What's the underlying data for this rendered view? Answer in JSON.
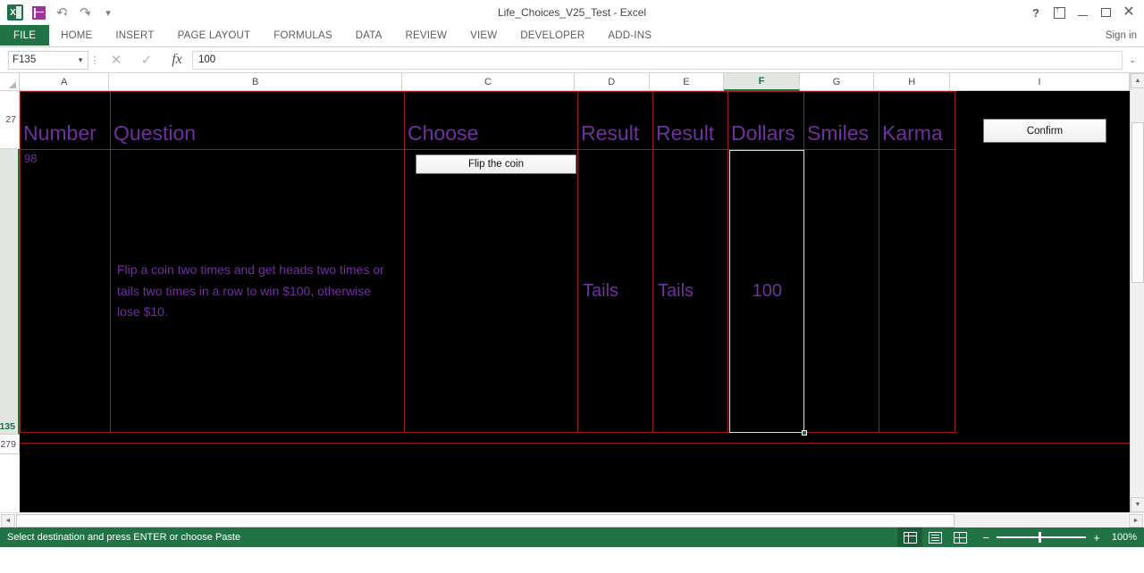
{
  "window": {
    "title": "Life_Choices_V25_Test - Excel",
    "quick_access": [
      {
        "name": "excel-logo",
        "label": "X"
      },
      {
        "name": "save-icon",
        "label": ""
      },
      {
        "name": "undo-icon",
        "label": "↶"
      },
      {
        "name": "redo-icon",
        "label": "↷"
      },
      {
        "name": "customize-qat-icon",
        "label": "▾"
      }
    ],
    "controls": {
      "help": "?",
      "ribbon_display": "",
      "minimize": "",
      "maximize": "",
      "close": "✕"
    }
  },
  "ribbon": {
    "tabs": [
      {
        "label": "FILE",
        "active": true
      },
      {
        "label": "HOME",
        "active": false
      },
      {
        "label": "INSERT",
        "active": false
      },
      {
        "label": "PAGE LAYOUT",
        "active": false
      },
      {
        "label": "FORMULAS",
        "active": false
      },
      {
        "label": "DATA",
        "active": false
      },
      {
        "label": "REVIEW",
        "active": false
      },
      {
        "label": "VIEW",
        "active": false
      },
      {
        "label": "DEVELOPER",
        "active": false
      },
      {
        "label": "ADD-INS",
        "active": false
      }
    ],
    "signin": "Sign in"
  },
  "formula_bar": {
    "name_box_value": "F135",
    "cancel_label": "✕",
    "enter_label": "✓",
    "fx_label": "fx",
    "formula_value": "100",
    "expand_label": "⌄"
  },
  "sheet": {
    "columns": [
      {
        "letter": "A",
        "selected": false
      },
      {
        "letter": "B",
        "selected": false
      },
      {
        "letter": "C",
        "selected": false
      },
      {
        "letter": "D",
        "selected": false
      },
      {
        "letter": "E",
        "selected": false
      },
      {
        "letter": "F",
        "selected": true
      },
      {
        "letter": "G",
        "selected": false
      },
      {
        "letter": "H",
        "selected": false
      },
      {
        "letter": "I",
        "selected": false
      }
    ],
    "rows": [
      {
        "number": "27",
        "selected": false
      },
      {
        "number": "135",
        "selected": true
      },
      {
        "number": "279",
        "selected": false
      }
    ],
    "header_row": {
      "A": "Number",
      "B": "Question",
      "C": "Choose",
      "D": "Result",
      "E": "Result",
      "F": "Dollars",
      "G": "Smiles",
      "H": "Karma"
    },
    "data_row": {
      "A": "98",
      "B": "Flip a coin two times and get heads two times or tails two times in a row to win $100, otherwise lose $10.",
      "D": "Tails",
      "E": "Tails",
      "F": "100"
    },
    "buttons": [
      {
        "name": "flip-the-coin-button",
        "label": "Flip the coin"
      },
      {
        "name": "confirm-button",
        "label": "Confirm"
      }
    ],
    "selected_cell": "F135",
    "colors": {
      "text_purple": "#7030A0",
      "border_red": "#9B1C1C",
      "background": "#000000",
      "accent_green": "#217346"
    }
  },
  "status_bar": {
    "message": "Select destination and press ENTER or choose Paste",
    "views": [
      {
        "name": "normal-view-button",
        "active": true
      },
      {
        "name": "page-layout-view-button",
        "active": false
      },
      {
        "name": "page-break-view-button",
        "active": false
      }
    ],
    "zoom_out_label": "−",
    "zoom_in_label": "+",
    "zoom_level": "100%"
  },
  "scrollbars": {
    "v_up": "▲",
    "v_down": "▼",
    "h_left": "◄",
    "h_right": "►"
  }
}
